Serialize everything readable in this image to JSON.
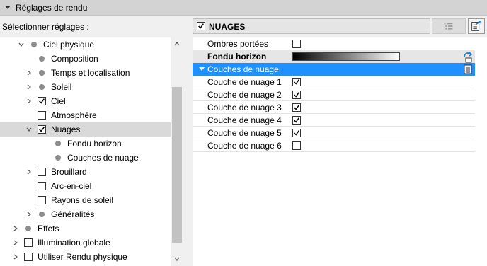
{
  "panel": {
    "title": "Réglages de rendu"
  },
  "selector": {
    "label": "Sélectionner réglages :"
  },
  "tree": [
    {
      "label": "Ciel physique",
      "level": 4,
      "expander": "down",
      "marker": "bullet",
      "selected": false
    },
    {
      "label": "Composition",
      "level": 5,
      "expander": "none",
      "marker": "bullet",
      "selected": false
    },
    {
      "label": "Temps et localisation",
      "level": 5,
      "expander": "right",
      "marker": "bullet",
      "selected": false
    },
    {
      "label": "Soleil",
      "level": 5,
      "expander": "right",
      "marker": "bullet",
      "selected": false
    },
    {
      "label": "Ciel",
      "level": 5,
      "expander": "right",
      "marker": "checked",
      "selected": false
    },
    {
      "label": "Atmosphère",
      "level": 5,
      "expander": "none",
      "marker": "unchecked",
      "selected": false
    },
    {
      "label": "Nuages",
      "level": 5,
      "expander": "down",
      "marker": "checked",
      "selected": true
    },
    {
      "label": "Fondu horizon",
      "level": 6,
      "expander": "none",
      "marker": "bullet",
      "selected": false
    },
    {
      "label": "Couches de nuage",
      "level": 6,
      "expander": "none",
      "marker": "bullet",
      "selected": false
    },
    {
      "label": "Brouillard",
      "level": 5,
      "expander": "right",
      "marker": "unchecked",
      "selected": false
    },
    {
      "label": "Arc-en-ciel",
      "level": 5,
      "expander": "none",
      "marker": "unchecked",
      "selected": false
    },
    {
      "label": "Rayons de soleil",
      "level": 5,
      "expander": "none",
      "marker": "unchecked",
      "selected": false
    },
    {
      "label": "Généralités",
      "level": 5,
      "expander": "right",
      "marker": "bullet",
      "selected": false
    },
    {
      "label": "Effets",
      "level": 3,
      "expander": "right",
      "marker": "bullet",
      "selected": false
    },
    {
      "label": "Illumination globale",
      "level": 3,
      "expander": "right",
      "marker": "unchecked",
      "selected": false
    },
    {
      "label": "Utiliser Rendu physique",
      "level": 3,
      "expander": "right",
      "marker": "unchecked",
      "selected": false
    }
  ],
  "header": {
    "title": "NUAGES",
    "checked": true
  },
  "properties": [
    {
      "label": "Ombres portées",
      "kind": "checkbox",
      "checked": false,
      "style": "normal"
    },
    {
      "label": "Fondu horizon",
      "kind": "gradient",
      "style": "bold"
    },
    {
      "label": "Couches de nuage",
      "kind": "section",
      "style": "highlight"
    },
    {
      "label": "Couche de nuage 1",
      "kind": "checkbox",
      "checked": true,
      "style": "normal"
    },
    {
      "label": "Couche de nuage 2",
      "kind": "checkbox",
      "checked": true,
      "style": "normal"
    },
    {
      "label": "Couche de nuage 3",
      "kind": "checkbox",
      "checked": true,
      "style": "normal"
    },
    {
      "label": "Couche de nuage 4",
      "kind": "checkbox",
      "checked": true,
      "style": "normal"
    },
    {
      "label": "Couche de nuage 5",
      "kind": "checkbox",
      "checked": true,
      "style": "normal"
    },
    {
      "label": "Couche de nuage 6",
      "kind": "checkbox",
      "checked": false,
      "style": "normal"
    }
  ],
  "icons": {
    "collapse": "triangle-down-icon",
    "list": "list-icon",
    "export": "export-icon",
    "refresh": "refresh-icon",
    "section": "list-small-icon"
  },
  "colors": {
    "highlight": "#1e90ff",
    "selected_row": "#d9d9d9",
    "bullet": "#8c8c8c",
    "title_bar": "#d3d3d3"
  }
}
